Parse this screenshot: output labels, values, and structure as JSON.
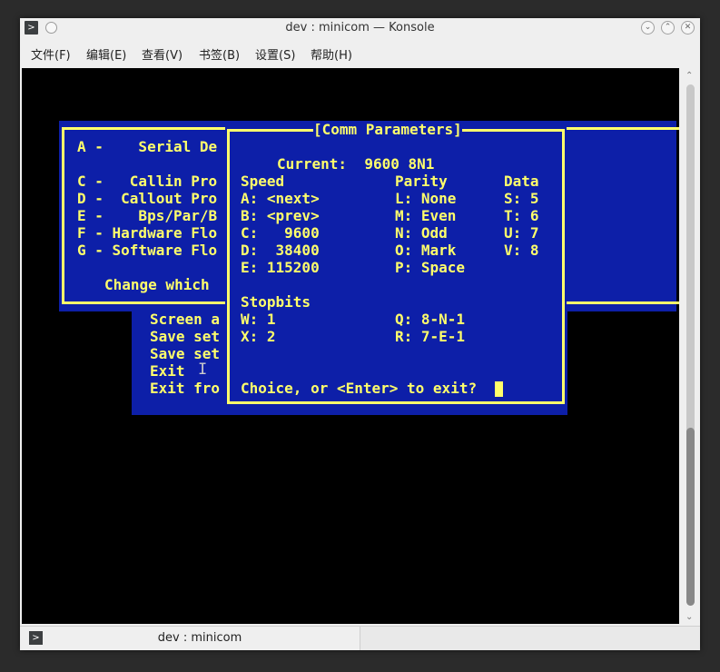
{
  "window": {
    "title": "dev : minicom — Konsole"
  },
  "menubar": [
    "文件(F)",
    "编辑(E)",
    "查看(V)",
    "书签(B)",
    "设置(S)",
    "帮助(H)"
  ],
  "tab": {
    "label": "dev : minicom"
  },
  "back_menu": {
    "items": [
      "A -    Serial De",
      "C -   Callin Pro",
      "D -  Callout Pro",
      "E -    Bps/Par/B",
      "F - Hardware Flo",
      "G - Software Flo"
    ],
    "prompt": "Change which"
  },
  "main_menu": {
    "items": [
      "Screen a",
      "Save set",
      "Save set",
      "Exit",
      "Exit fro"
    ]
  },
  "comm": {
    "title": "[Comm Parameters]",
    "current": "Current:  9600 8N1",
    "speed_header": "Speed",
    "parity_header": "Parity",
    "data_header": "Data",
    "speed": [
      "A: <next>",
      "B: <prev>",
      "C:   9600",
      "D:  38400",
      "E: 115200"
    ],
    "parity": [
      "L: None",
      "M: Even",
      "N: Odd",
      "O: Mark",
      "P: Space"
    ],
    "data": [
      "S: 5",
      "T: 6",
      "U: 7",
      "V: 8"
    ],
    "stopbits_header": "Stopbits",
    "stopbits": [
      "W: 1",
      "X: 2"
    ],
    "presets": [
      "Q: 8-N-1",
      "R: 7-E-1"
    ],
    "prompt": "Choice, or <Enter> to exit?"
  },
  "colors": {
    "dialog_bg": "#0d1fa8",
    "dialog_fg": "#ffff6b",
    "terminal_bg": "#000000"
  }
}
